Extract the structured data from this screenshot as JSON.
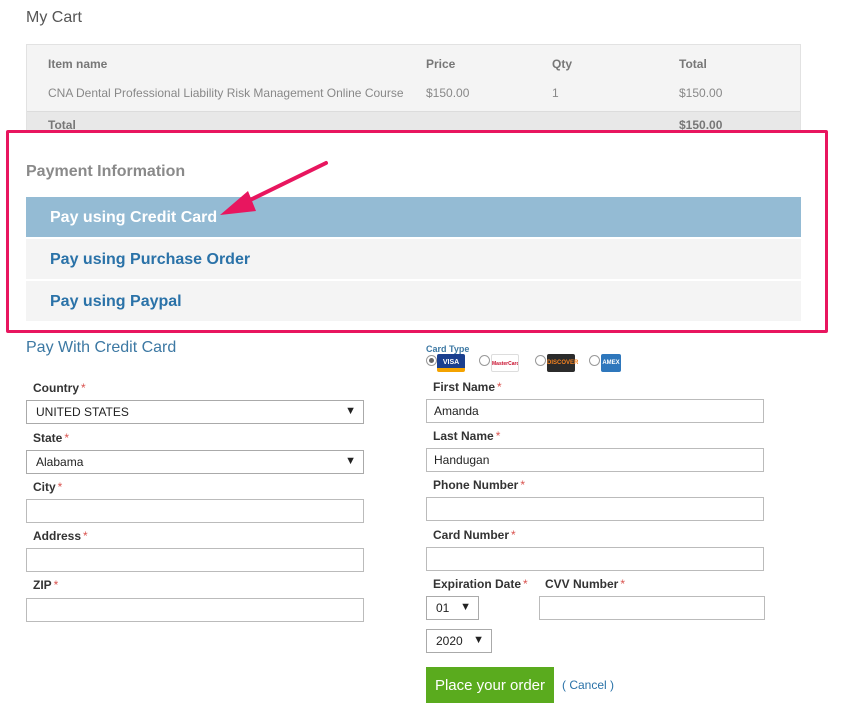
{
  "cart": {
    "title": "My Cart",
    "headers": {
      "item": "Item name",
      "price": "Price",
      "qty": "Qty",
      "total": "Total"
    },
    "row": {
      "item": "CNA Dental Professional Liability Risk Management Online Course",
      "price": "$150.00",
      "qty": "1",
      "total": "$150.00"
    },
    "total_label": "Total",
    "total_value": "$150.00"
  },
  "payment": {
    "title": "Payment Information",
    "options": [
      {
        "label": "Pay using Credit Card",
        "active": true
      },
      {
        "label": "Pay using Purchase Order",
        "active": false
      },
      {
        "label": "Pay using Paypal",
        "active": false
      }
    ]
  },
  "credit_card": {
    "title": "Pay With Credit Card",
    "country_label": "Country",
    "country_value": "UNITED STATES",
    "state_label": "State",
    "state_value": "Alabama",
    "city_label": "City",
    "address_label": "Address",
    "zip_label": "ZIP",
    "card_type_label": "Card Type",
    "card_types": [
      "VISA",
      "MasterCard",
      "DISCOVER",
      "AMEX"
    ],
    "first_name_label": "First Name",
    "first_name_value": "Amanda",
    "last_name_label": "Last Name",
    "last_name_value": "Handugan",
    "phone_label": "Phone Number",
    "card_number_label": "Card Number",
    "expiration_label": "Expiration Date",
    "exp_month": "01",
    "exp_year": "2020",
    "cvv_label": "CVV Number",
    "required_mark": "*"
  },
  "actions": {
    "place_order": "Place your order",
    "cancel": "( Cancel )"
  },
  "colors": {
    "highlight": "#e8165f",
    "active_option_bg": "#94bbd4",
    "link": "#2a72a8",
    "button": "#5aab1e"
  }
}
